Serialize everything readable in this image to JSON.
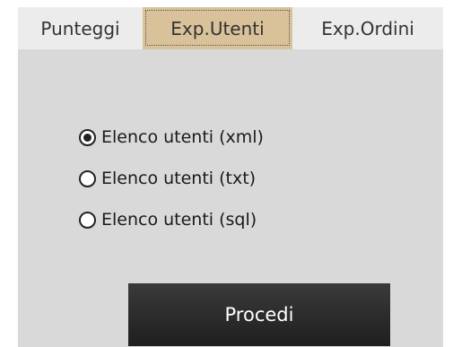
{
  "tabs": [
    {
      "label": "Punteggi",
      "selected": false
    },
    {
      "label": "Exp.Utenti",
      "selected": true
    },
    {
      "label": "Exp.Ordini",
      "selected": false
    }
  ],
  "options": [
    {
      "label": "Elenco utenti (xml)",
      "checked": true
    },
    {
      "label": "Elenco utenti (txt)",
      "checked": false
    },
    {
      "label": "Elenco utenti (sql)",
      "checked": false
    }
  ],
  "button": {
    "label": "Procedi"
  },
  "colors": {
    "selected_tab": "#d9c29a",
    "tab_background": "#ececec",
    "panel_background": "#d9d9d9",
    "button_background": "#2b2b2b"
  }
}
